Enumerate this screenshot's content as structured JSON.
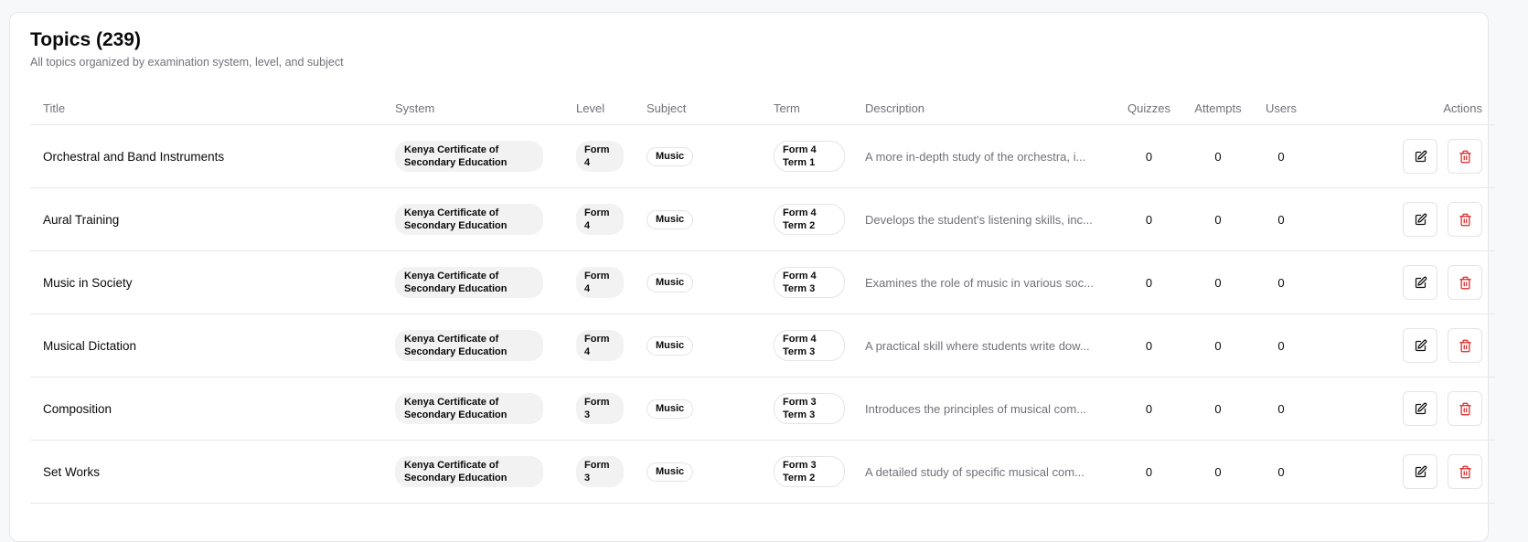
{
  "header": {
    "title": "Topics (239)",
    "subtitle": "All topics organized by examination system, level, and subject"
  },
  "table": {
    "columns": {
      "title": "Title",
      "system": "System",
      "level": "Level",
      "subject": "Subject",
      "term": "Term",
      "description": "Description",
      "quizzes": "Quizzes",
      "attempts": "Attempts",
      "users": "Users",
      "actions": "Actions"
    },
    "rows": [
      {
        "title": "Orchestral and Band Instruments",
        "system_l1": "Kenya Certificate of",
        "system_l2": "Secondary Education",
        "level_l1": "Form",
        "level_l2": "4",
        "subject": "Music",
        "term_l1": "Form 4",
        "term_l2": "Term 1",
        "description": "A more in-depth study of the orchestra, i...",
        "quizzes": "0",
        "attempts": "0",
        "users": "0"
      },
      {
        "title": "Aural Training",
        "system_l1": "Kenya Certificate of",
        "system_l2": "Secondary Education",
        "level_l1": "Form",
        "level_l2": "4",
        "subject": "Music",
        "term_l1": "Form 4",
        "term_l2": "Term 2",
        "description": "Develops the student's listening skills, inc...",
        "quizzes": "0",
        "attempts": "0",
        "users": "0"
      },
      {
        "title": "Music in Society",
        "system_l1": "Kenya Certificate of",
        "system_l2": "Secondary Education",
        "level_l1": "Form",
        "level_l2": "4",
        "subject": "Music",
        "term_l1": "Form 4",
        "term_l2": "Term 3",
        "description": "Examines the role of music in various soc...",
        "quizzes": "0",
        "attempts": "0",
        "users": "0"
      },
      {
        "title": "Musical Dictation",
        "system_l1": "Kenya Certificate of",
        "system_l2": "Secondary Education",
        "level_l1": "Form",
        "level_l2": "4",
        "subject": "Music",
        "term_l1": "Form 4",
        "term_l2": "Term 3",
        "description": "A practical skill where students write dow...",
        "quizzes": "0",
        "attempts": "0",
        "users": "0"
      },
      {
        "title": "Composition",
        "system_l1": "Kenya Certificate of",
        "system_l2": "Secondary Education",
        "level_l1": "Form",
        "level_l2": "3",
        "subject": "Music",
        "term_l1": "Form 3",
        "term_l2": "Term 3",
        "description": "Introduces the principles of musical com...",
        "quizzes": "0",
        "attempts": "0",
        "users": "0"
      },
      {
        "title": "Set Works",
        "system_l1": "Kenya Certificate of",
        "system_l2": "Secondary Education",
        "level_l1": "Form",
        "level_l2": "3",
        "subject": "Music",
        "term_l1": "Form 3",
        "term_l2": "Term 2",
        "description": "A detailed study of specific musical com...",
        "quizzes": "0",
        "attempts": "0",
        "users": "0"
      }
    ],
    "row_actions": {
      "edit_icon": "edit-icon",
      "delete_icon": "trash-icon"
    }
  },
  "colors": {
    "delete": "#dc2626",
    "muted": "#71717a",
    "border": "#e5e7eb"
  }
}
